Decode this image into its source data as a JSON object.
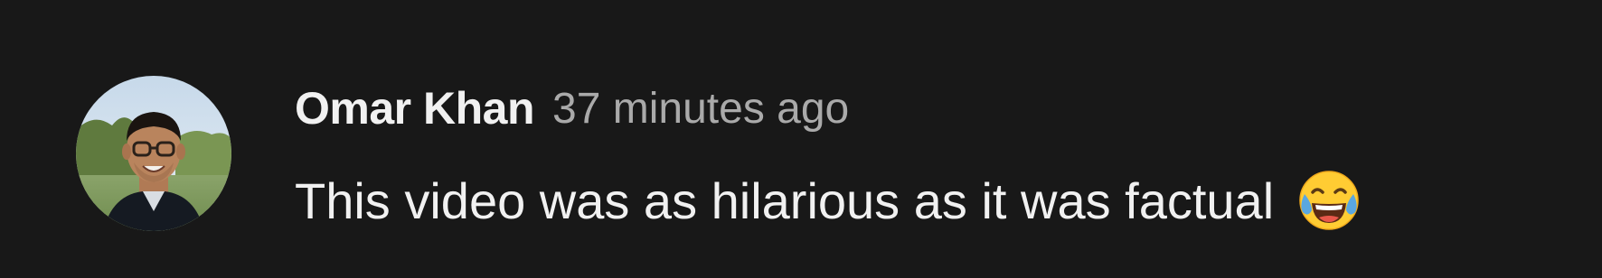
{
  "comment": {
    "author": "Omar Khan",
    "timestamp": "37 minutes ago",
    "text": "This video was as hilarious as it was factual",
    "emoji": "face-with-tears-of-joy"
  },
  "colors": {
    "background": "#181818",
    "author": "#f1f1f1",
    "timestamp": "#aaaaaa",
    "text": "#f1f1f1",
    "emoji": "#ffcc33"
  }
}
